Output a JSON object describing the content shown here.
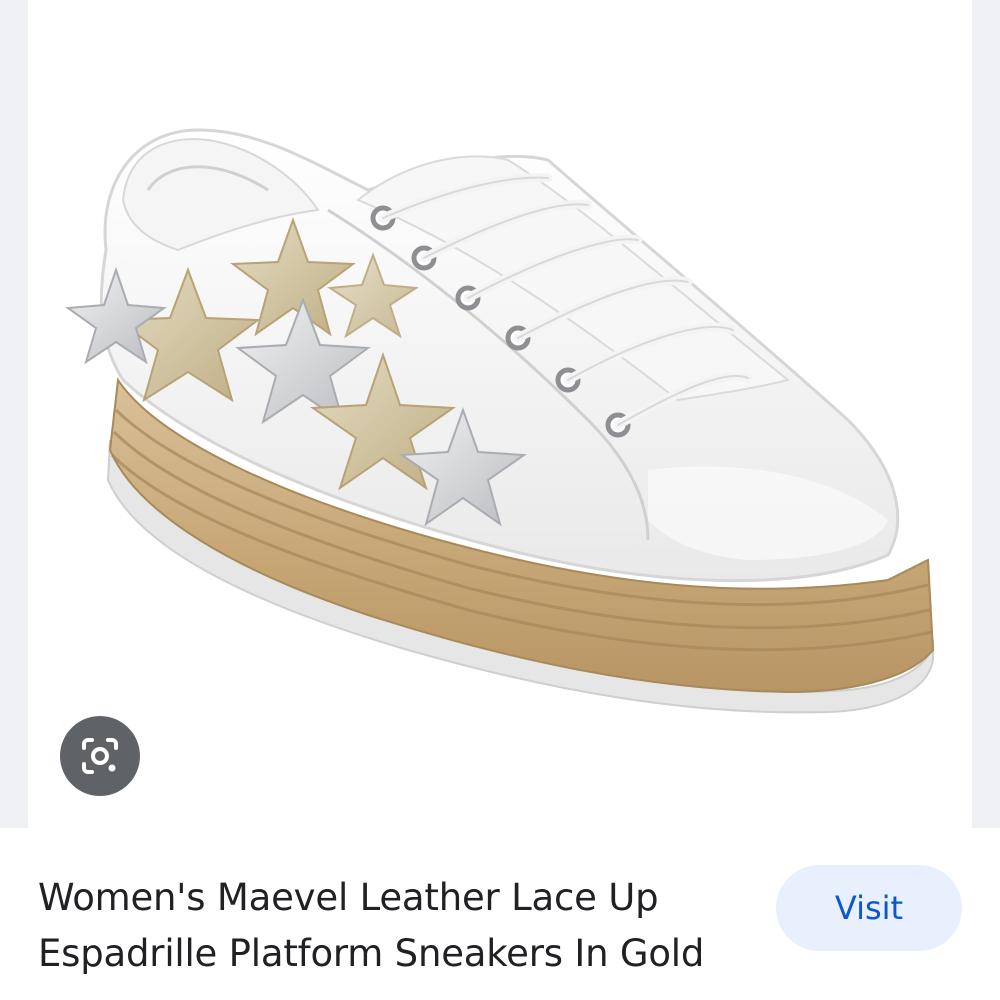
{
  "product": {
    "image_alt": "Women's Maevel Leather Lace Up Espadrille Platform Sneakers In Gold",
    "title_line1": "Women's Maevel Leather Lace Up",
    "title_line2": "Espadrille Platform Sneakers In Gold"
  },
  "actions": {
    "visit_label": "Visit",
    "lens_icon": "lens-camera-icon"
  },
  "colors": {
    "accent": "#0b57d0",
    "visit_bg": "#e8f0fe",
    "lens_bg": "#5f6368"
  }
}
